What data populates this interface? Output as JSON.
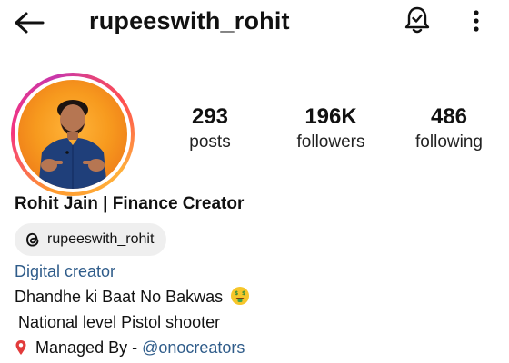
{
  "header": {
    "username": "rupeeswith_rohit",
    "back_icon": "arrow-left-icon",
    "notification_icon": "bell-check-icon",
    "more_icon": "more-vertical-icon"
  },
  "profile": {
    "avatar": "profile-photo",
    "story_ring_colors": [
      "#ff9a2e",
      "#f5347f",
      "#c837ab"
    ],
    "stats": [
      {
        "value": "293",
        "label": "posts"
      },
      {
        "value": "196K",
        "label": "followers"
      },
      {
        "value": "486",
        "label": "following"
      }
    ],
    "display_name": "Rohit Jain | Finance Creator",
    "threads_handle": "rupeeswith_rohit",
    "category": "Digital creator",
    "bio": {
      "line1": "Dhandhe ki Baat No Bakwas",
      "line1_emoji": "money-mouth-face-emoji",
      "line2": "National level Pistol shooter",
      "line3_prefix": "Managed By - ",
      "line3_icon": "pin-icon",
      "line3_mention": "@onocreators"
    }
  },
  "colors": {
    "link": "#2f5c8a",
    "chip_bg": "#efefef",
    "avatar_bg": "#f79a1e"
  }
}
